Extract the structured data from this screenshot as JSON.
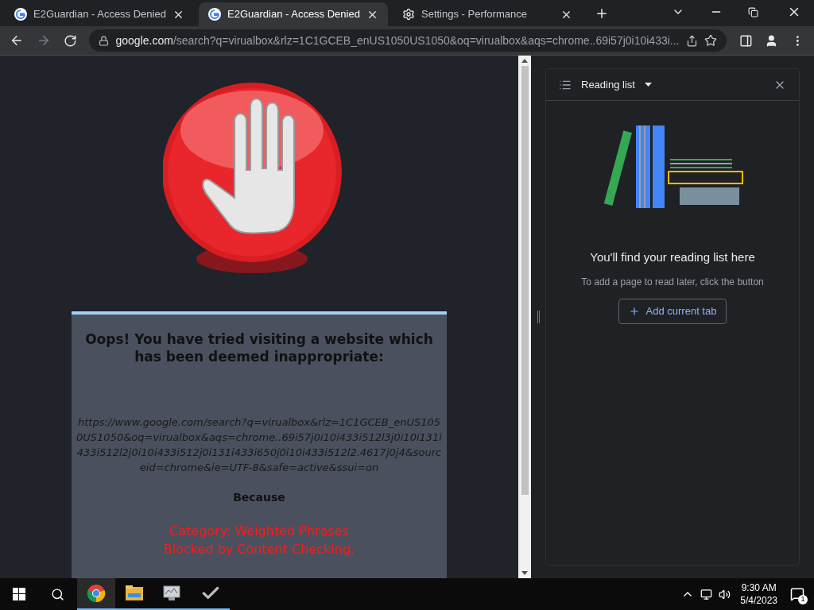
{
  "tabs": [
    {
      "title": "E2Guardian - Access Denied",
      "kind": "site",
      "selected": false
    },
    {
      "title": "E2Guardian - Access Denied",
      "kind": "site",
      "selected": true
    },
    {
      "title": "Settings - Performance",
      "kind": "settings",
      "selected": false
    }
  ],
  "address": {
    "host": "google.com",
    "path": "/search?q=virualbox&rlz=1C1GCEB_enUS1050US1050&oq=virualbox&aqs=chrome..69i57j0i10i433i..."
  },
  "page": {
    "heading": "Oops! You have tried visiting a website which has been deemed inappropriate:",
    "url": "https://www.google.com/search?q=virualbox&rlz=1C1GCEB_enUS1050US1050&oq=virualbox&aqs=chrome..69i57j0i10i433i512l3j0i10i131i433i512l2j0i10i433i512j0i131i433i650j0i10i433i512l2.4617j0j4&sourceid=chrome&ie=UTF-8&safe=active&ssui=on",
    "because": "Because",
    "reasons": [
      "Category: Weighted Phrases",
      "Blocked by Content Checking."
    ]
  },
  "side_panel": {
    "title": "Reading list",
    "empty_title": "You'll find your reading list here",
    "empty_text": "To add a page to read later, click the button",
    "button": "Add current tab"
  },
  "taskbar": {
    "apps": [
      {
        "kind": "chrome",
        "active": true
      },
      {
        "kind": "folder",
        "active": false
      },
      {
        "kind": "monitor",
        "active": false
      },
      {
        "kind": "check",
        "active": false
      }
    ],
    "time": "9:30 AM",
    "date": "5/4/2023",
    "notifications": "1"
  }
}
